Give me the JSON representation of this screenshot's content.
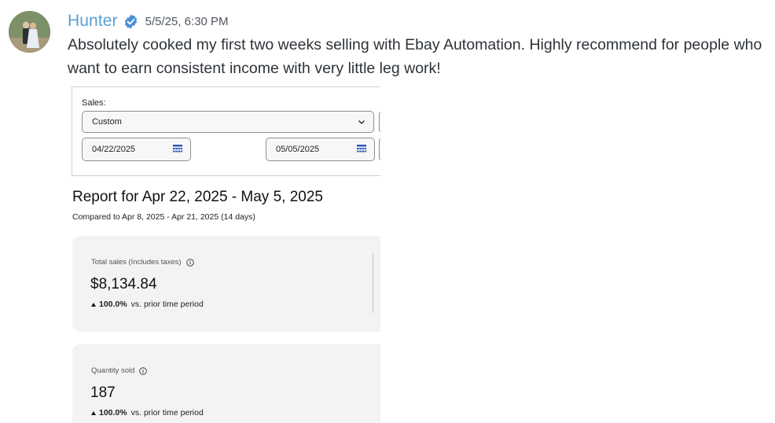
{
  "message": {
    "username": "Hunter",
    "verified_icon": "verified-badge-icon",
    "timestamp": "5/5/25, 6:30 PM",
    "text": "Absolutely cooked my first two weeks selling with Ebay Automation. Highly recommend for people who want to earn consistent income with very little leg work!"
  },
  "colors": {
    "username": "#5a9fd0",
    "badge": "#4a90d9",
    "card_bg": "#f3f3f3"
  },
  "report": {
    "sales_label": "Sales:",
    "period_select": "Custom",
    "start_date": "04/22/2025",
    "end_date": "05/05/2025",
    "title": "Report for Apr 22, 2025 - May 5, 2025",
    "comparison": "Compared to Apr 8, 2025 - Apr 21, 2025 (14 days)",
    "metrics": [
      {
        "label": "Total sales (Includes taxes)",
        "value": "$8,134.84",
        "change": "100.0%",
        "change_text": "vs. prior time period"
      },
      {
        "label": "Quantity sold",
        "value": "187",
        "change": "100.0%",
        "change_text": "vs. prior time period"
      }
    ]
  }
}
